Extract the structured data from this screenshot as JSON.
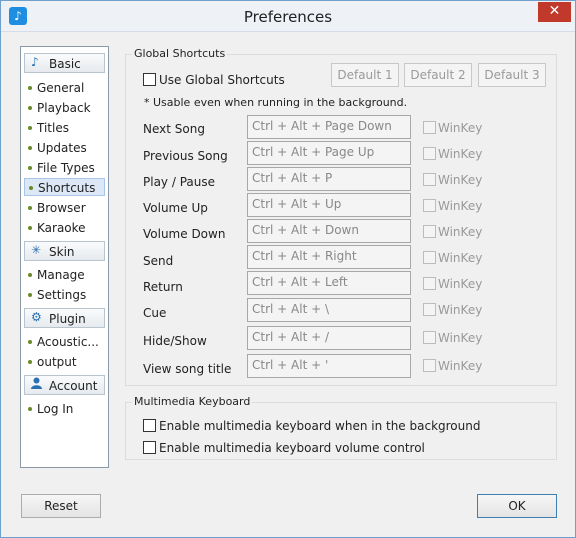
{
  "window": {
    "title": "Preferences",
    "app_icon": "music-note-icon",
    "close_glyph": "✕"
  },
  "nav": {
    "groups": [
      {
        "label": "Basic",
        "icon": "music-note-icon",
        "glyph": "♪",
        "items": [
          "General",
          "Playback",
          "Titles",
          "Updates",
          "File Types",
          "Shortcuts",
          "Browser",
          "Karaoke"
        ]
      },
      {
        "label": "Skin",
        "icon": "sparkle-icon",
        "glyph": "✳",
        "items": [
          "Manage",
          "Settings"
        ]
      },
      {
        "label": "Plugin",
        "icon": "gear-icon",
        "glyph": "⚙",
        "items": [
          "Acoustic...",
          "output"
        ]
      },
      {
        "label": "Account",
        "icon": "user-icon",
        "glyph": "👤",
        "items": [
          "Log In"
        ]
      }
    ],
    "selected": "Shortcuts"
  },
  "global_shortcuts": {
    "title": "Global Shortcuts",
    "use_label": "Use Global Shortcuts",
    "use_checked": false,
    "default_buttons": [
      "Default 1",
      "Default 2",
      "Default 3"
    ],
    "note": "* Usable even when running in the background.",
    "winkey_label": "WinKey",
    "rows": [
      {
        "name": "Next Song",
        "keys": "Ctrl + Alt + Page Down"
      },
      {
        "name": "Previous Song",
        "keys": "Ctrl + Alt + Page Up"
      },
      {
        "name": "Play / Pause",
        "keys": "Ctrl + Alt + P"
      },
      {
        "name": "Volume Up",
        "keys": "Ctrl + Alt + Up"
      },
      {
        "name": "Volume Down",
        "keys": "Ctrl + Alt + Down"
      },
      {
        "name": "Send",
        "keys": "Ctrl + Alt + Right"
      },
      {
        "name": "Return",
        "keys": "Ctrl + Alt + Left"
      },
      {
        "name": "Cue",
        "keys": "Ctrl + Alt + \\"
      },
      {
        "name": "Hide/Show",
        "keys": "Ctrl + Alt + /"
      },
      {
        "name": "View song title",
        "keys": "Ctrl + Alt + '"
      }
    ]
  },
  "multimedia": {
    "title": "Multimedia Keyboard",
    "options": [
      {
        "label": "Enable multimedia keyboard when in the background",
        "checked": false
      },
      {
        "label": "Enable multimedia keyboard volume control",
        "checked": false
      }
    ]
  },
  "footer": {
    "reset_label": "Reset",
    "ok_label": "OK"
  }
}
